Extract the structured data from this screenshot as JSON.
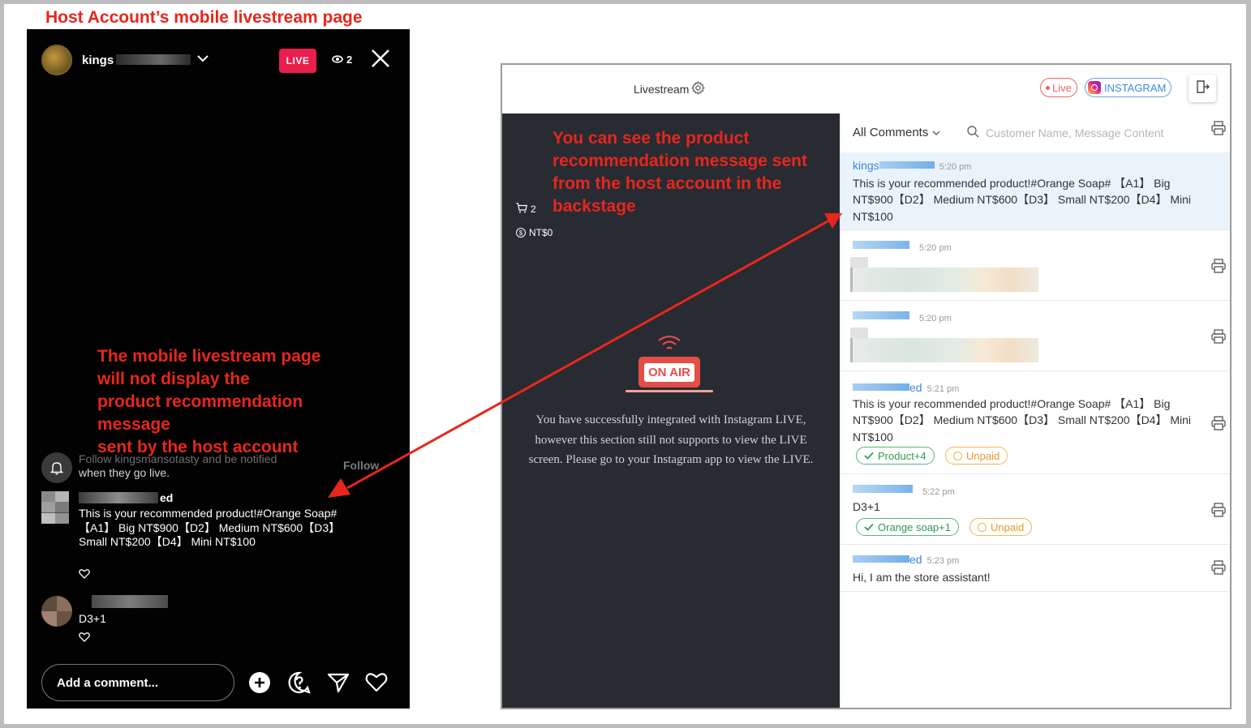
{
  "caption_top": "Host Account’s mobile livestream page",
  "mobile": {
    "username_prefix": "kings",
    "live_label": "LIVE",
    "viewer_count": "2",
    "annotation_lines": [
      "The mobile livestream page",
      "will not display the",
      "product recommendation",
      "message",
      "sent by the host account"
    ],
    "follow_text_main": "Follow kingsmansotasty and be notified",
    "follow_text_sub": "when they go live.",
    "follow_button": "Follow",
    "comment1_user_suffix": "ed",
    "comment1_text": "This is your recommended product!#Orange Soap# 【A1】 Big NT$900【D2】 Medium NT$600【D3】 Small NT$200【D4】 Mini NT$100",
    "comment2_text": "D3+1",
    "comment_placeholder": "Add a comment..."
  },
  "backstage": {
    "title": "Livestream",
    "live_pill": "Live",
    "instagram_pill": "INSTAGRAM",
    "cart_count": "2",
    "total_amount": "NT$0",
    "annotation_lines": [
      "You can see the product",
      "recommendation message sent",
      "from the host account in the",
      "backstage"
    ],
    "on_air_label": "ON AIR",
    "on_air_message": "You have successfully integrated with Instagram LIVE, however this section still not supports to view the LIVE screen. Please go to your Instagram app to view the LIVE.",
    "filter_label": "All Comments",
    "search_placeholder": "Customer Name, Message Content",
    "comments": [
      {
        "name": "kings",
        "time": "5:20 pm",
        "text": "This is your recommended product!#Orange Soap# 【A1】 Big NT$900【D2】 Medium NT$600【D3】 Small NT$200【D4】 Mini NT$100"
      },
      {
        "name": "",
        "time": "5:20 pm",
        "text": ""
      },
      {
        "name": "",
        "time": "5:20 pm",
        "text": ""
      },
      {
        "name": "ed",
        "time": "5:21 pm",
        "text": "This is your recommended product!#Orange Soap# 【A1】 Big NT$900【D2】 Medium NT$600【D3】 Small NT$200【D4】 Mini NT$100",
        "tags": [
          "Product+4",
          "Unpaid"
        ]
      },
      {
        "name": "",
        "time": "5:22 pm",
        "text": "D3+1",
        "tags": [
          "Orange soap+1",
          "Unpaid"
        ]
      },
      {
        "name": "ed",
        "time": "5:23 pm",
        "text": "Hi, I am the store assistant!"
      }
    ]
  },
  "colors": {
    "annotation_red": "#e8261d",
    "live_pink": "#e91e4c",
    "panel_dark": "#282b32",
    "link_blue": "#3d88d8",
    "highlight_bg": "#e8f3fc"
  }
}
